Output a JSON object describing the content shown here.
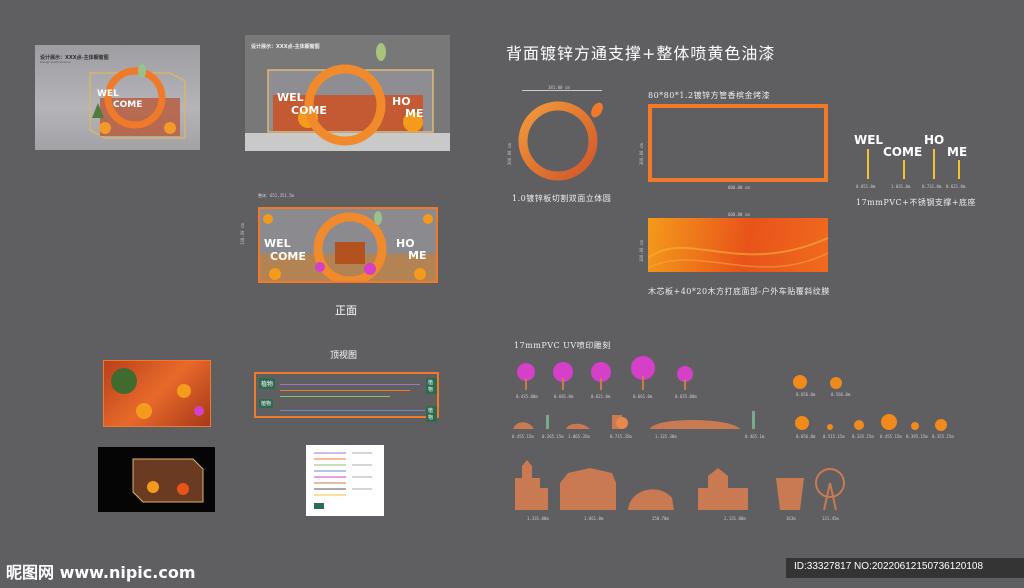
{
  "header": {
    "title": "背面镀锌方通支撑+整体喷黄色油漆"
  },
  "render1": {
    "caption": "设计展示：XXX点-主体橱窗图",
    "subcaption": "Design performance"
  },
  "render2": {
    "caption": "设计展示：XXX点-主体橱窗图"
  },
  "front_view": {
    "dim_top": "整体：652,351.5m",
    "label": "正面",
    "dim_side": "138.39 cm"
  },
  "welcome_parts": {
    "wel": "WEL",
    "come": "COME",
    "ho": "HO",
    "me": "ME"
  },
  "ring": {
    "dim_top": "381.00 cm",
    "dim_side": "300.00 cm",
    "caption": "1.0镀锌板切割双面立体圆"
  },
  "frame": {
    "title": "80*80*1.2镀锌方管香槟金烤漆",
    "dim_bottom": "600.00 cm",
    "dim_side": "300.00 cm"
  },
  "panel": {
    "dim_top": "600.00 cm",
    "dim_side": "100.00 cm",
    "caption": "木芯板+40*20木方打底面部-户外车贴覆斜纹膜"
  },
  "letters": {
    "caption": "17mmPVC+不锈钢支撑+底座",
    "dims": [
      "0.051.0m",
      "1.031.0m",
      "0.731.0m",
      "0.621.0m"
    ]
  },
  "top_view": {
    "label": "顶视图",
    "plant1": "植物",
    "plant2": "植物",
    "plant3": "植物",
    "plant4": "植物"
  },
  "pvc": {
    "title": "17mmPVC UV喷印雕刻"
  },
  "tree_dims": [
    "0.435.00m",
    "0.681.0m",
    "0.621.0m",
    "0.661.0m",
    "0.635.00m"
  ],
  "plant_dims": [
    "0.455.15m",
    "0.265.15m",
    "1.065.35m",
    "0.715.35m",
    "1.135.30m",
    "0.465.1m"
  ],
  "fruit_dims_top": [
    "0.656.0m",
    "0.566.0m"
  ],
  "fruit_dims_bottom": [
    "0.656.0m",
    "0.515.15m",
    "0.335.15m",
    "0.455.15m",
    "0.395.15m",
    "0.355.15m"
  ],
  "building_dims": [
    "1.331.00m",
    "1.661.0m",
    "250.70m",
    "2.131.00m",
    "163m",
    "131.45m"
  ],
  "watermark": {
    "site": "昵图网 www.nipic.com",
    "id": "ID:33327817 NO:20220612150736120108"
  },
  "colors": {
    "bg": "#5f5f62",
    "orange": "#f07a2a",
    "deep_orange": "#e85a1a",
    "magenta": "#d63fc8",
    "copper": "#c97a52",
    "gold": "#f2c230"
  }
}
